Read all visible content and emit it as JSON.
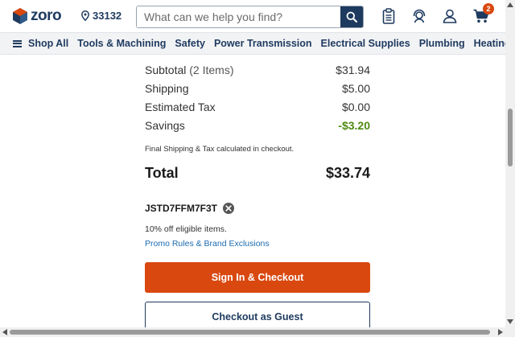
{
  "header": {
    "logo_text": "zoro",
    "location_zip": "33132",
    "search_placeholder": "What can we help you find?",
    "cart_count": "2",
    "icons": [
      "list-clipboard-icon",
      "support-agent-icon",
      "account-user-icon",
      "cart-icon"
    ]
  },
  "nav": {
    "items": [
      "Shop All",
      "Tools & Machining",
      "Safety",
      "Power Transmission",
      "Electrical Supplies",
      "Plumbing",
      "Heating & Cooling"
    ]
  },
  "summary": {
    "subtotal_label": "Subtotal",
    "subtotal_items": "(2 Items)",
    "subtotal_value": "$31.94",
    "shipping_label": "Shipping",
    "shipping_value": "$5.00",
    "tax_label": "Estimated Tax",
    "tax_value": "$0.00",
    "savings_label": "Savings",
    "savings_value": "-$3.20",
    "note": "Final Shipping & Tax calculated in checkout.",
    "total_label": "Total",
    "total_value": "$33.74"
  },
  "promo": {
    "code": "JSTD7FFM7F3T",
    "description": "10% off eligible items.",
    "link": "Promo Rules & Brand Exclusions"
  },
  "buttons": {
    "sign_in_checkout": "Sign In & Checkout",
    "guest_checkout": "Checkout as Guest"
  },
  "colors": {
    "brand_navy": "#1e3a5f",
    "accent_orange": "#d9480f",
    "savings_green": "#4f8a10",
    "link_blue": "#1b6bb0"
  }
}
